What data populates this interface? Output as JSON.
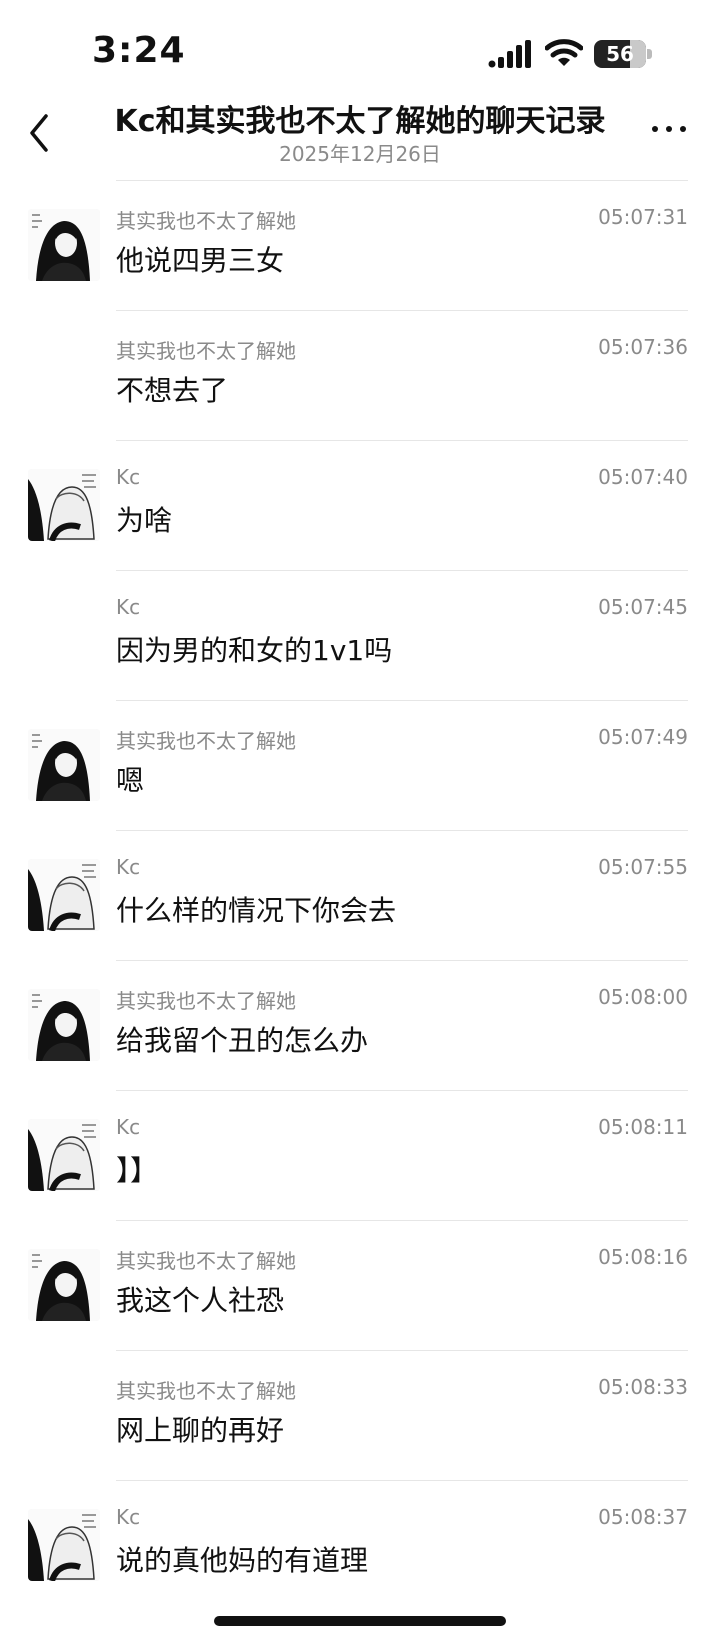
{
  "status": {
    "time": "3:24",
    "battery": "56"
  },
  "header": {
    "title": "Kc和其实我也不太了解她的聊天记录",
    "date": "2025年12月26日"
  },
  "messages": [
    {
      "sender": "其实我也不太了解她",
      "time": "05:07:31",
      "text": "他说四男三女",
      "avatar": "dark-hair"
    },
    {
      "sender": "其实我也不太了解她",
      "time": "05:07:36",
      "text": "不想去了",
      "avatar": ""
    },
    {
      "sender": "Kc",
      "time": "05:07:40",
      "text": "为啥",
      "avatar": "light-hair"
    },
    {
      "sender": "Kc",
      "time": "05:07:45",
      "text": "因为男的和女的1v1吗",
      "avatar": ""
    },
    {
      "sender": "其实我也不太了解她",
      "time": "05:07:49",
      "text": "嗯",
      "avatar": "dark-hair"
    },
    {
      "sender": "Kc",
      "time": "05:07:55",
      "text": "什么样的情况下你会去",
      "avatar": "light-hair"
    },
    {
      "sender": "其实我也不太了解她",
      "time": "05:08:00",
      "text": "给我留个丑的怎么办",
      "avatar": "dark-hair"
    },
    {
      "sender": "Kc",
      "time": "05:08:11",
      "text": "】】",
      "avatar": "light-hair"
    },
    {
      "sender": "其实我也不太了解她",
      "time": "05:08:16",
      "text": "我这个人社恐",
      "avatar": "dark-hair"
    },
    {
      "sender": "其实我也不太了解她",
      "time": "05:08:33",
      "text": "网上聊的再好",
      "avatar": ""
    },
    {
      "sender": "Kc",
      "time": "05:08:37",
      "text": "说的真他妈的有道理",
      "avatar": "light-hair"
    }
  ]
}
